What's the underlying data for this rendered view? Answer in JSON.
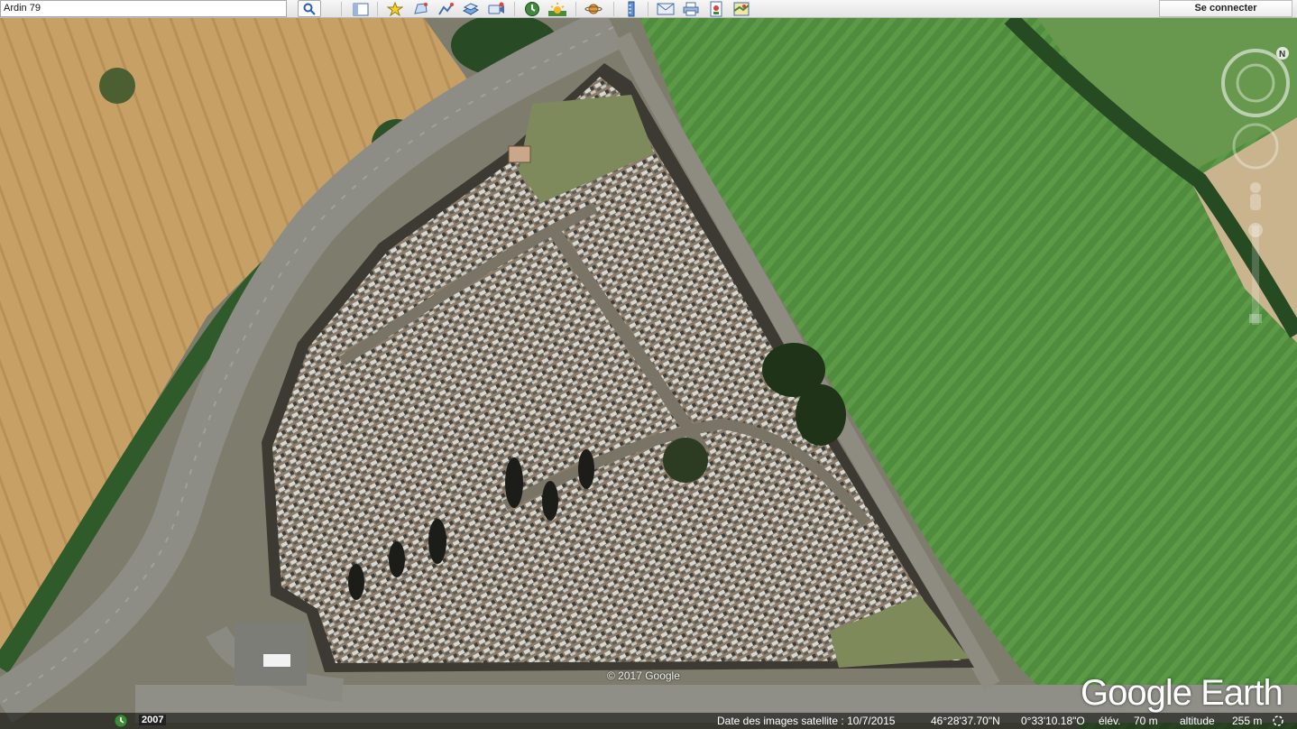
{
  "search": {
    "value": "Ardin  79"
  },
  "toolbar": {
    "login_label": "Se connecter",
    "icons": [
      "search-icon",
      "sidebar-icon",
      "placemark-icon",
      "polygon-icon",
      "path-icon",
      "overlay-icon",
      "record-tour-icon",
      "historical-imagery-icon",
      "sunlight-icon",
      "planets-icon",
      "ruler-icon",
      "email-icon",
      "print-icon",
      "save-image-icon",
      "map-view-icon"
    ]
  },
  "map": {
    "copyright": "© 2017 Google",
    "logo": "Google Earth",
    "compass_label": "N"
  },
  "status": {
    "year": "2007",
    "imagery_date": "Date des images satellite : 10/7/2015",
    "latitude": "46°28'37.70\"N",
    "longitude": "0°33'10.18\"O",
    "elevation_label": "élév.",
    "elevation_value": "70 m",
    "altitude_label": "altitude",
    "altitude_value": "255 m"
  },
  "colors": {
    "toolbar_bg": "#eeeeee",
    "field_dry": "#c9a46a",
    "field_green": "#4e8a3e",
    "road": "#8f8f88",
    "cemetery_ground": "#8a7a68"
  }
}
